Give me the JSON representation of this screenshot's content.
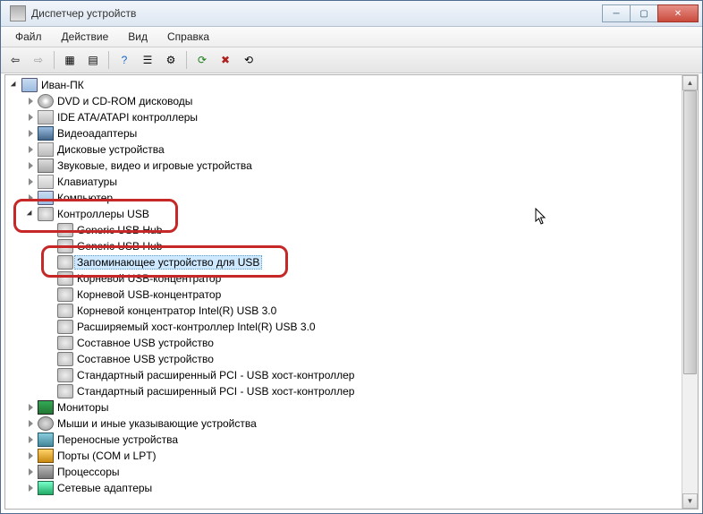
{
  "window": {
    "title": "Диспетчер устройств"
  },
  "menu": {
    "file": "Файл",
    "action": "Действие",
    "view": "Вид",
    "help": "Справка"
  },
  "tree": {
    "root": "Иван-ПК",
    "cat_dvd": "DVD и CD-ROM дисководы",
    "cat_ide": "IDE ATA/ATAPI контроллеры",
    "cat_video": "Видеоадаптеры",
    "cat_disk": "Дисковые устройства",
    "cat_audio": "Звуковые, видео и игровые устройства",
    "cat_keyboard": "Клавиатуры",
    "cat_computer": "Компьютер",
    "cat_usb": "Контроллеры USB",
    "usb_generic1": "Generic USB Hub",
    "usb_generic2": "Generic USB Hub",
    "usb_storage": "Запоминающее устройство для USB",
    "usb_root1": "Корневой USB-концентратор",
    "usb_root2": "Корневой USB-концентратор",
    "usb_root_intel": "Корневой концентратор Intel(R) USB 3.0",
    "usb_ext_host": "Расширяемый хост-контроллер Intel(R) USB 3.0",
    "usb_composite1": "Составное USB устройство",
    "usb_composite2": "Составное USB устройство",
    "usb_pci1": "Стандартный расширенный PCI - USB хост-контроллер",
    "usb_pci2": "Стандартный расширенный PCI - USB хост-контроллер",
    "cat_monitor": "Мониторы",
    "cat_mouse": "Мыши и иные указывающие устройства",
    "cat_portable": "Переносные устройства",
    "cat_ports": "Порты (COM и LPT)",
    "cat_cpu": "Процессоры",
    "cat_net": "Сетевые адаптеры"
  }
}
